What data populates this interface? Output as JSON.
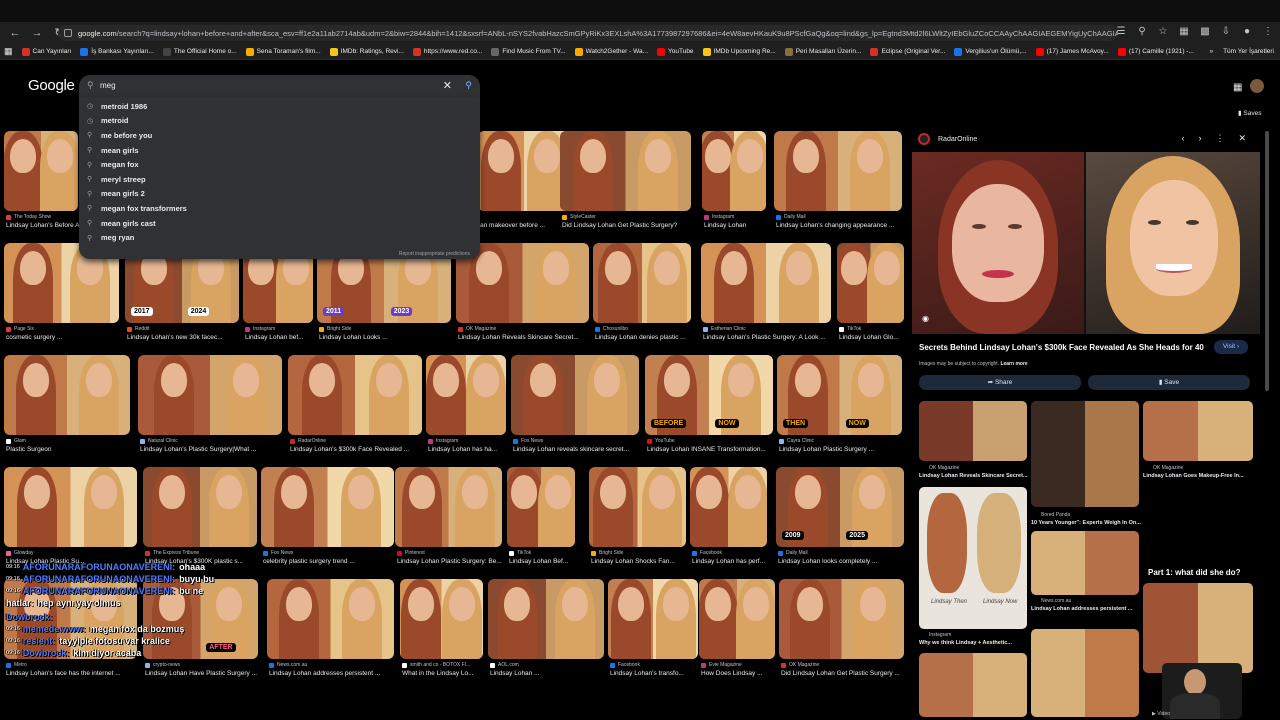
{
  "browser": {
    "url_host": "google.com",
    "url_rest": "/search?q=lindsay+lohan+before+and+after&sca_esv=ff1e2a11ab2714ab&udm=2&biw=2844&bih=1412&sxsrf=ANbL-nSYS2fvabHazcSmGPyRiKx3EXLshA%3A1773987297686&ei=4eW8aevHKauK9u8PScfGaQg&oq=lind&gs_lp=Egtnd3Mtd2l6LWltZyIEbGluZCoCCAAyChAAGIAEGEMYigUyChAAGIAEGEMYigUyChAAGIAEGEMYigUyChAAGIAEGE..."
  },
  "bookmarks": [
    {
      "label": "Can Yayınları",
      "color": "#d93025"
    },
    {
      "label": "İş Bankası Yayınları...",
      "color": "#1a73e8"
    },
    {
      "label": "The Official Home o...",
      "color": "#444"
    },
    {
      "label": "Sena Toraman's film...",
      "color": "#f9ab00"
    },
    {
      "label": "IMDb: Ratings, Revi...",
      "color": "#f5c518"
    },
    {
      "label": "https://www.red.co...",
      "color": "#d93025"
    },
    {
      "label": "Find Music From TV...",
      "color": "#666"
    },
    {
      "label": "Watch2Gether - Wa...",
      "color": "#f9ab00"
    },
    {
      "label": "YouTube",
      "color": "#ff0000"
    },
    {
      "label": "IMDb Upcoming Re...",
      "color": "#f5c518"
    },
    {
      "label": "Peri Masalları Üzerin...",
      "color": "#8a6d3b"
    },
    {
      "label": "Eclipse (Original Ver...",
      "color": "#d93025"
    },
    {
      "label": "Vergilius'un Ölümü,...",
      "color": "#1a73e8"
    },
    {
      "label": "(17) James McAvoy...",
      "color": "#ff0000"
    },
    {
      "label": "(17) Camille (1921) -...",
      "color": "#ff0000"
    }
  ],
  "bookmarks_more": "»",
  "bookmarks_all": "Tüm Yer İşaretleri",
  "google": {
    "logo": "Google",
    "query": "meg",
    "suggestions": [
      "metroid 1986",
      "metroid",
      "me before you",
      "mean girls",
      "megan fox",
      "meryl streep",
      "mean girls 2",
      "megan fox transformers",
      "mean girls cast",
      "meg ryan"
    ],
    "report": "Report inappropriate predictions",
    "saves": "Saves"
  },
  "rows": [
    [
      {
        "source": "The Today Show",
        "caption": "Lindsay Lohan's Before A...",
        "dot": "#e53935"
      },
      {
        "source": "",
        "caption": "",
        "dot": "#000"
      },
      {
        "source": "",
        "caption": "",
        "dot": "#000"
      },
      {
        "source": "",
        "caption": "an makeover before ...",
        "dot": "#000"
      },
      {
        "source": "StyleCaster",
        "caption": "Did Lindsay Lohan Get Plastic Surgery?",
        "dot": "#f9ab00"
      },
      {
        "source": "Instagram",
        "caption": "Lindsay Lohan",
        "dot": "#c13584"
      },
      {
        "source": "Daily Mail",
        "caption": "Lindsay Lohan's changing appearance ...",
        "dot": "#1a73e8"
      }
    ],
    [
      {
        "source": "Page Six",
        "caption": "cosmetic surgery ...",
        "dot": "#e53935"
      },
      {
        "source": "Reddit",
        "caption": "Lindsay Lohan's new 30k facec...",
        "dot": "#ff4500"
      },
      {
        "source": "Instagram",
        "caption": "Lindsay Lohan bef...",
        "dot": "#c13584"
      },
      {
        "source": "Bright Side",
        "caption": "Lindsay Lohan Looks ...",
        "dot": "#f9ab00"
      },
      {
        "source": "OK Magazine",
        "caption": "Lindsay Lohan Reveals Skincare Secret...",
        "dot": "#d93025"
      },
      {
        "source": "Chosunilbo",
        "caption": "Lindsay Lohan denies plastic ...",
        "dot": "#1a73e8"
      },
      {
        "source": "Estherian Clinic",
        "caption": "Lindsay Lohan's Plastic Surgery: A Look ...",
        "dot": "#8ab4f8"
      },
      {
        "source": "TikTok",
        "caption": "Lindsay Lohan Glo...",
        "dot": "#fff"
      }
    ],
    [
      {
        "source": "Glam",
        "caption": "Plastic Surgeon",
        "dot": "#fff"
      },
      {
        "source": "Natural Clinic",
        "caption": "Lindsay Lohan's Plastic Surgery|What ...",
        "dot": "#8ab4f8"
      },
      {
        "source": "RadarOnline",
        "caption": "Lindsay Lohan's $300k Face Revealed ...",
        "dot": "#c62828"
      },
      {
        "source": "Instagram",
        "caption": "Lindsay Lohan has ha...",
        "dot": "#c13584"
      },
      {
        "source": "Fox News",
        "caption": "Lindsay Lohan reveals skincare secret...",
        "dot": "#1a73e8"
      },
      {
        "source": "YouTube",
        "caption": "Lindsay Lohan INSANE Transformation...",
        "dot": "#ff0000"
      },
      {
        "source": "Cayra Clinic",
        "caption": "Lindsay Lohan Plastic Surgery ...",
        "dot": "#8ab4f8"
      }
    ],
    [
      {
        "source": "Glowday",
        "caption": "Lindsay Lohan Plastic Su...",
        "dot": "#f06292"
      },
      {
        "source": "The Express Tribune",
        "caption": "Lindsay Lohan's $300K plastic s...",
        "dot": "#d93025"
      },
      {
        "source": "Fox News",
        "caption": "celebrity plastic surgery trend ...",
        "dot": "#1a73e8"
      },
      {
        "source": "Pinterest",
        "caption": "Lindsay Lohan Plastic Surgery: Be...",
        "dot": "#e60023"
      },
      {
        "source": "TikTok",
        "caption": "Lindsay Lohan Bef...",
        "dot": "#fff"
      },
      {
        "source": "Bright Side",
        "caption": "Lindsay Lohan Shocks Fan...",
        "dot": "#f9ab00"
      },
      {
        "source": "Facebook",
        "caption": "Lindsay Lohan has perf...",
        "dot": "#1877f2"
      },
      {
        "source": "Daily Mail",
        "caption": "Lindsay Lohan looks completely ...",
        "dot": "#1a73e8"
      }
    ],
    [
      {
        "source": "Metro",
        "caption": "Lindsay Lohan's face has the internet ...",
        "dot": "#1a73e8"
      },
      {
        "source": "crypto-news",
        "caption": "Lindsay Lohan Have Plastic Surgery ...",
        "dot": "#8ab4f8"
      },
      {
        "source": "News.com.au",
        "caption": "Lindsay Lohan addresses persistent ...",
        "dot": "#1a73e8"
      },
      {
        "source": "smith and co - BOTOX FI...",
        "caption": "What in the Lindsay Lo...",
        "dot": "#fff"
      },
      {
        "source": "AOL.com",
        "caption": "Lindsay Lohan ...",
        "dot": "#fff"
      },
      {
        "source": "Facebook",
        "caption": "Lindsay Lohan's transfo...",
        "dot": "#1877f2"
      },
      {
        "source": "Evie Magazine",
        "caption": "How Does Lindsay ...",
        "dot": "#c13584"
      },
      {
        "source": "OK Magazine",
        "caption": "Did Lindsay Lohan Get Plastic Surgery ...",
        "dot": "#d93025"
      }
    ]
  ],
  "overlay_badges": {
    "y2017": "2017",
    "y2024": "2024",
    "y2011": "2011",
    "y2023": "2023",
    "y2024b": "2024",
    "before": "BEFORE",
    "now": "NOW",
    "then": "THEN",
    "now2": "NOW",
    "after": "AFTER",
    "before2": "BEFORE",
    "after2": "AFTER",
    "y2009": "2009",
    "y2025": "2025",
    "before_after": "BEFORE AFTER"
  },
  "panel": {
    "source": "RadarOnline",
    "title": "Secrets Behind Lindsay Lohan's $300k Face Revealed As She Heads for 40",
    "visit": "Visit",
    "copyright": "Images may be subject to copyright.",
    "learn_more": "Learn more",
    "share": "Share",
    "save": "Save",
    "related": [
      {
        "source": "OK Magazine",
        "caption": "Lindsay Lohan Reveals Skincare Secret..."
      },
      {
        "source": "",
        "caption": ""
      },
      {
        "source": "OK Magazine",
        "caption": "Lindsay Lohan Goes Makeup-Free In..."
      },
      {
        "source": "Bored Panda",
        "caption": "10 Years Younger\": Experts Weigh In On..."
      },
      {
        "source": "News.com.au",
        "caption": "Lindsay Lohan addresses persistent ..."
      },
      {
        "source": "Instagram",
        "caption": "Why we think Lindsay + Aesthetic..."
      }
    ],
    "part1": "Part 1: what did she do?",
    "video_label": "Video",
    "lindsay_then": "Lindsay Then",
    "lindsay_now": "Lindsay Now"
  },
  "chat": [
    {
      "time": "09:16",
      "user": "AFORUNARAFORUNAONAVERENI:",
      "msg": "ohaaa",
      "color": "#4f7bff"
    },
    {
      "time": "09:16",
      "user": "AFORUNARAFORUNAONAVERENI:",
      "msg": "buyu bu",
      "color": "#4f7bff"
    },
    {
      "time": "09:16",
      "user": "AFORUNARAFORUNAONAVERENI:",
      "msg": "bu ne",
      "color": "#4f7bff"
    },
    {
      "time": "",
      "user": "hatlar:",
      "msg": "hep aynı yay olmus",
      "color": "#fff"
    },
    {
      "time": "",
      "user": "Dowbrock:",
      "msg": "",
      "color": "#4f7bff"
    },
    {
      "time": "09:16",
      "user": "memede.www:",
      "msg": "megan fox da bozmuş",
      "color": "#4f7bff"
    },
    {
      "time": "09:16",
      "user": "resient:",
      "msg": "tayyiple fotosu var kralice",
      "color": "#4f7bff"
    },
    {
      "time": "09:16",
      "user": "Dowbrock:",
      "msg": "kim diyor acaba",
      "color": "#4f7bff"
    }
  ]
}
